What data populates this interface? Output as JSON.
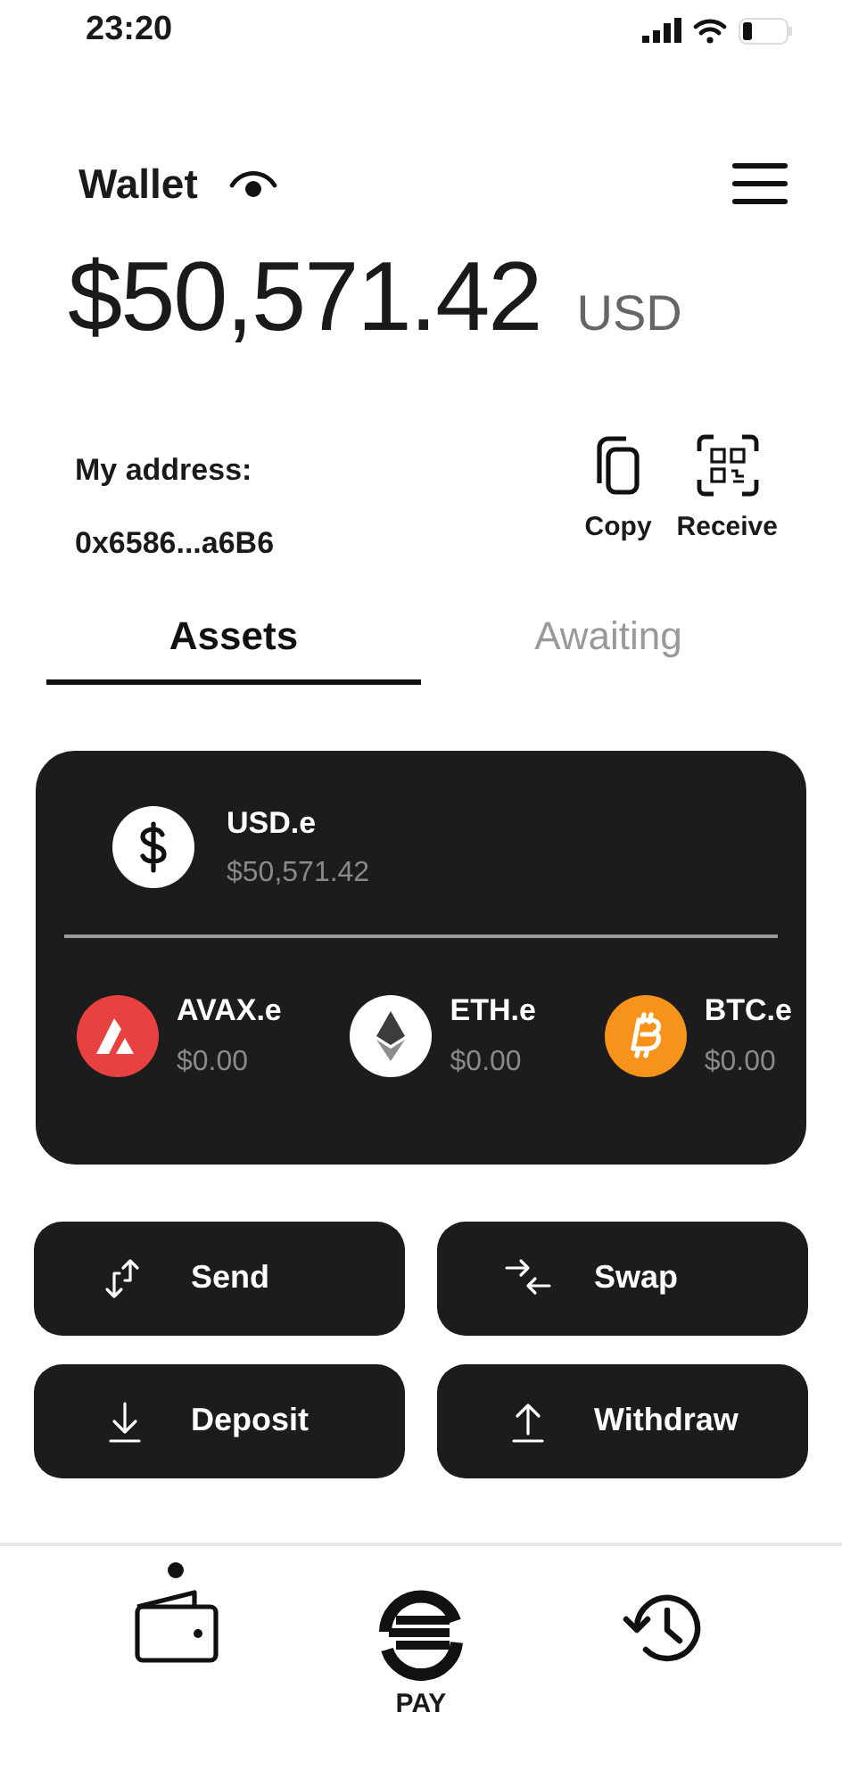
{
  "status_bar": {
    "time": "23:20"
  },
  "header": {
    "title": "Wallet",
    "balance": "$50,571.42",
    "currency": "USD"
  },
  "address": {
    "label": "My address:",
    "value": "0x6586...a6B6",
    "actions": [
      {
        "kind": "copy",
        "label": "Copy"
      },
      {
        "kind": "receive",
        "label": "Receive"
      }
    ]
  },
  "tabs": [
    {
      "label": "Assets",
      "selected": true
    },
    {
      "label": "Awaiting",
      "selected": false
    }
  ],
  "main_asset": {
    "kind": "dollar",
    "name": "USD.e",
    "value": "$50,571.42"
  },
  "assets": [
    {
      "kind": "avax",
      "name": "AVAX.e",
      "value": "$0.00"
    },
    {
      "kind": "eth",
      "name": "ETH.e",
      "value": "$0.00"
    },
    {
      "kind": "btc",
      "name": "BTC.e",
      "value": "$0.00"
    }
  ],
  "actions": [
    {
      "kind": "send",
      "label": "Send"
    },
    {
      "kind": "swap",
      "label": "Swap"
    },
    {
      "kind": "deposit",
      "label": "Deposit"
    },
    {
      "kind": "withdraw",
      "label": "Withdraw"
    }
  ],
  "nav": [
    {
      "kind": "wallet",
      "selected": true
    },
    {
      "kind": "pay",
      "label": "PAY",
      "selected": false
    },
    {
      "kind": "history",
      "selected": false
    }
  ]
}
